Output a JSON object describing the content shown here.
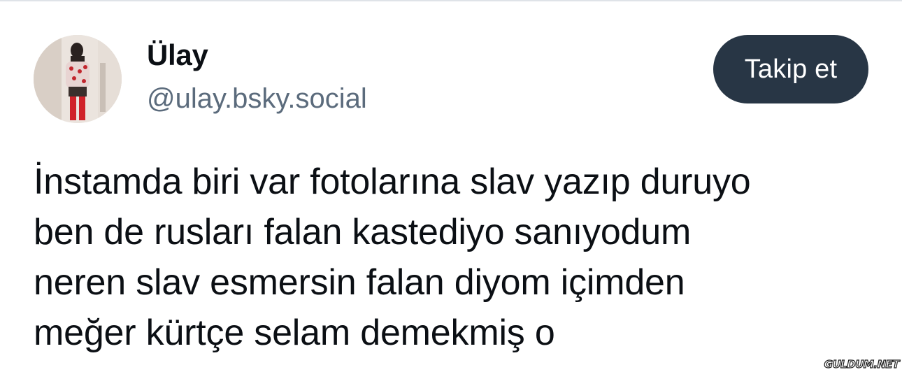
{
  "author": {
    "display_name": "Ülay",
    "handle": "@ulay.bsky.social",
    "avatar_icon": "profile-photo"
  },
  "actions": {
    "follow_label": "Takip et"
  },
  "post": {
    "lines": [
      "İnstamda biri var fotolarına slav yazıp duruyo",
      "ben de rusları falan kastediyo sanıyodum",
      "neren slav esmersin falan diyom içimden",
      "meğer kürtçe selam demekmiş o"
    ]
  },
  "watermark": {
    "text": "GULDUM.NET"
  },
  "colors": {
    "button_bg": "#283645",
    "handle_text": "#5b6b7c",
    "body_text": "#0b0f14"
  }
}
